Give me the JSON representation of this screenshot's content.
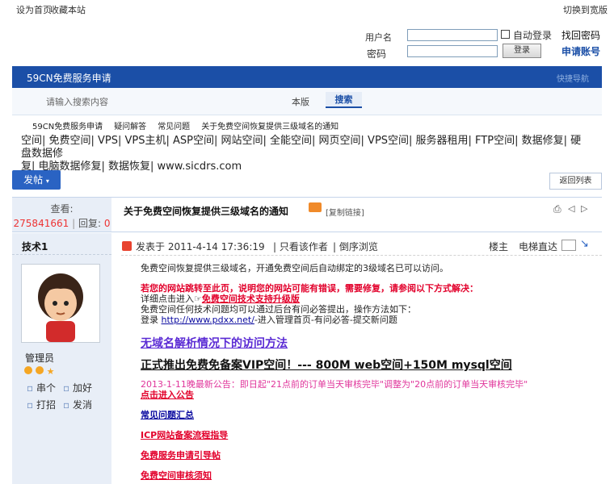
{
  "top": {
    "set_home": "设为首页",
    "bookmark": "收藏本站",
    "switch_wide": "切换到宽版"
  },
  "login": {
    "username_label": "用户名",
    "password_label": "密码",
    "auto_login": "自动登录",
    "forgot": "找回密码",
    "submit": "登录",
    "register": "申请账号"
  },
  "nav": {
    "brand": "59CN免费服务申请",
    "right_text": "快捷导航"
  },
  "search": {
    "placeholder": "请输入搜索内容",
    "scope": "本版",
    "button": "搜索"
  },
  "breadcrumb": [
    "59CN免费服务申请",
    "疑问解答",
    "常见问题",
    "关于免费空间恢复提供三级域名的通知"
  ],
  "ad": {
    "line1": "空间| 免费空间| VPS| VPS主机| ASP空间| 网站空间| 全能空间| 网页空间| VPS空间| 服务器租用| FTP空间| 数据修复| 硬盘数据修",
    "line2": "复| 电脑数据修复| 数据恢复| www.sicdrs.com"
  },
  "actions": {
    "post": "发帖",
    "back": "返回列表"
  },
  "thread": {
    "views_label": "查看:",
    "views": "275841661",
    "sep": "|",
    "replies_label": "回复:",
    "replies": "0",
    "title": "关于免费空间恢复提供三级域名的通知",
    "copy_link": "[复制链接]"
  },
  "author": {
    "name": "技术1",
    "group": "管理员",
    "btn_dm": "串个",
    "btn_add_friend": "加好",
    "btn_poke": "打招",
    "btn_message": "发消"
  },
  "post": {
    "posted_at": "发表于 2011-4-14 17:36:19",
    "only_author": "只看该作者",
    "reverse": "倒序浏览",
    "floor": "楼主",
    "jump": "电梯直达"
  },
  "content": {
    "p1": "免费空间恢复提供三级域名，开通免费空间后自动绑定的3级域名已可以访问。",
    "p2": "若您的网站跳转至此页，说明您的网站可能有错误，需要修复，请参阅以下方式解决：",
    "p3_prefix": "详细点击进入☞",
    "p3_link": "免费空间技术支持升级版",
    "p4": "免费空间任何技术问题均可以通过后台有问必答提出，操作方法如下：",
    "p5_prefix": "登录",
    "p5_link": "http://www.pdxx.net/",
    "p5_suffix": "-进入管理首页-有问必答-提交新问题",
    "h1": "无域名解析情况下的访问方法",
    "h2": "正式推出免费免备案VIP空间！--- 800M web空间+150M mysql空间",
    "notice": "2013-1-11晚最新公告：即日起\"21点前的订单当天审核完毕\"调整为\"20点前的订单当天审核完毕\"",
    "notice_link": "点击进入公告",
    "l1": "常见问题汇总",
    "l2": "ICP网站备案流程指导",
    "l3": "免费服务申请引导帖",
    "l4": "免费空间审核须知"
  },
  "colors": {
    "nav": "#1b4fa7",
    "link_blue": "#0b0ba0",
    "link_purple": "#5a2ad4",
    "red": "#e2002b",
    "pink": "#e0359b",
    "stat_red": "#e33"
  }
}
